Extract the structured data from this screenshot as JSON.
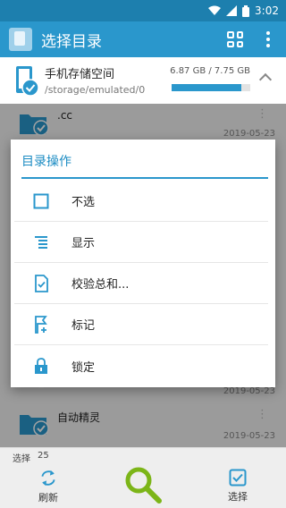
{
  "status_bar": {
    "time": "3:02",
    "icons": [
      "wifi-icon",
      "signal-icon",
      "battery-icon"
    ]
  },
  "app_bar": {
    "title": "选择目录",
    "actions": [
      "grid-view-icon",
      "more-vert-icon"
    ]
  },
  "storage": {
    "name": "手机存储空间",
    "path": "/storage/emulated/0",
    "size": "6.87 GB / 7.75 GB",
    "used_fraction": 0.886
  },
  "files": [
    {
      "name": ".cc",
      "date": "2019-05-23"
    },
    {
      "name": "",
      "date": "2019-05-23"
    },
    {
      "name": "自动精灵",
      "date": "2019-05-23"
    }
  ],
  "dialog": {
    "title": "目录操作",
    "items": [
      {
        "label": "不选",
        "icon": "checkbox-icon"
      },
      {
        "label": "显示",
        "icon": "list-icon"
      },
      {
        "label": "校验总和...",
        "icon": "checksum-icon"
      },
      {
        "label": "标记",
        "icon": "bookmark-icon"
      },
      {
        "label": "锁定",
        "icon": "lock-icon"
      }
    ]
  },
  "selection": {
    "label": "选择",
    "count": "25"
  },
  "bottom_bar": {
    "refresh_label": "刷新",
    "select_label": "选择"
  },
  "colors": {
    "primary": "#2a97cc",
    "status_bar": "#1d7fae",
    "accent_green": "#7cb518"
  }
}
